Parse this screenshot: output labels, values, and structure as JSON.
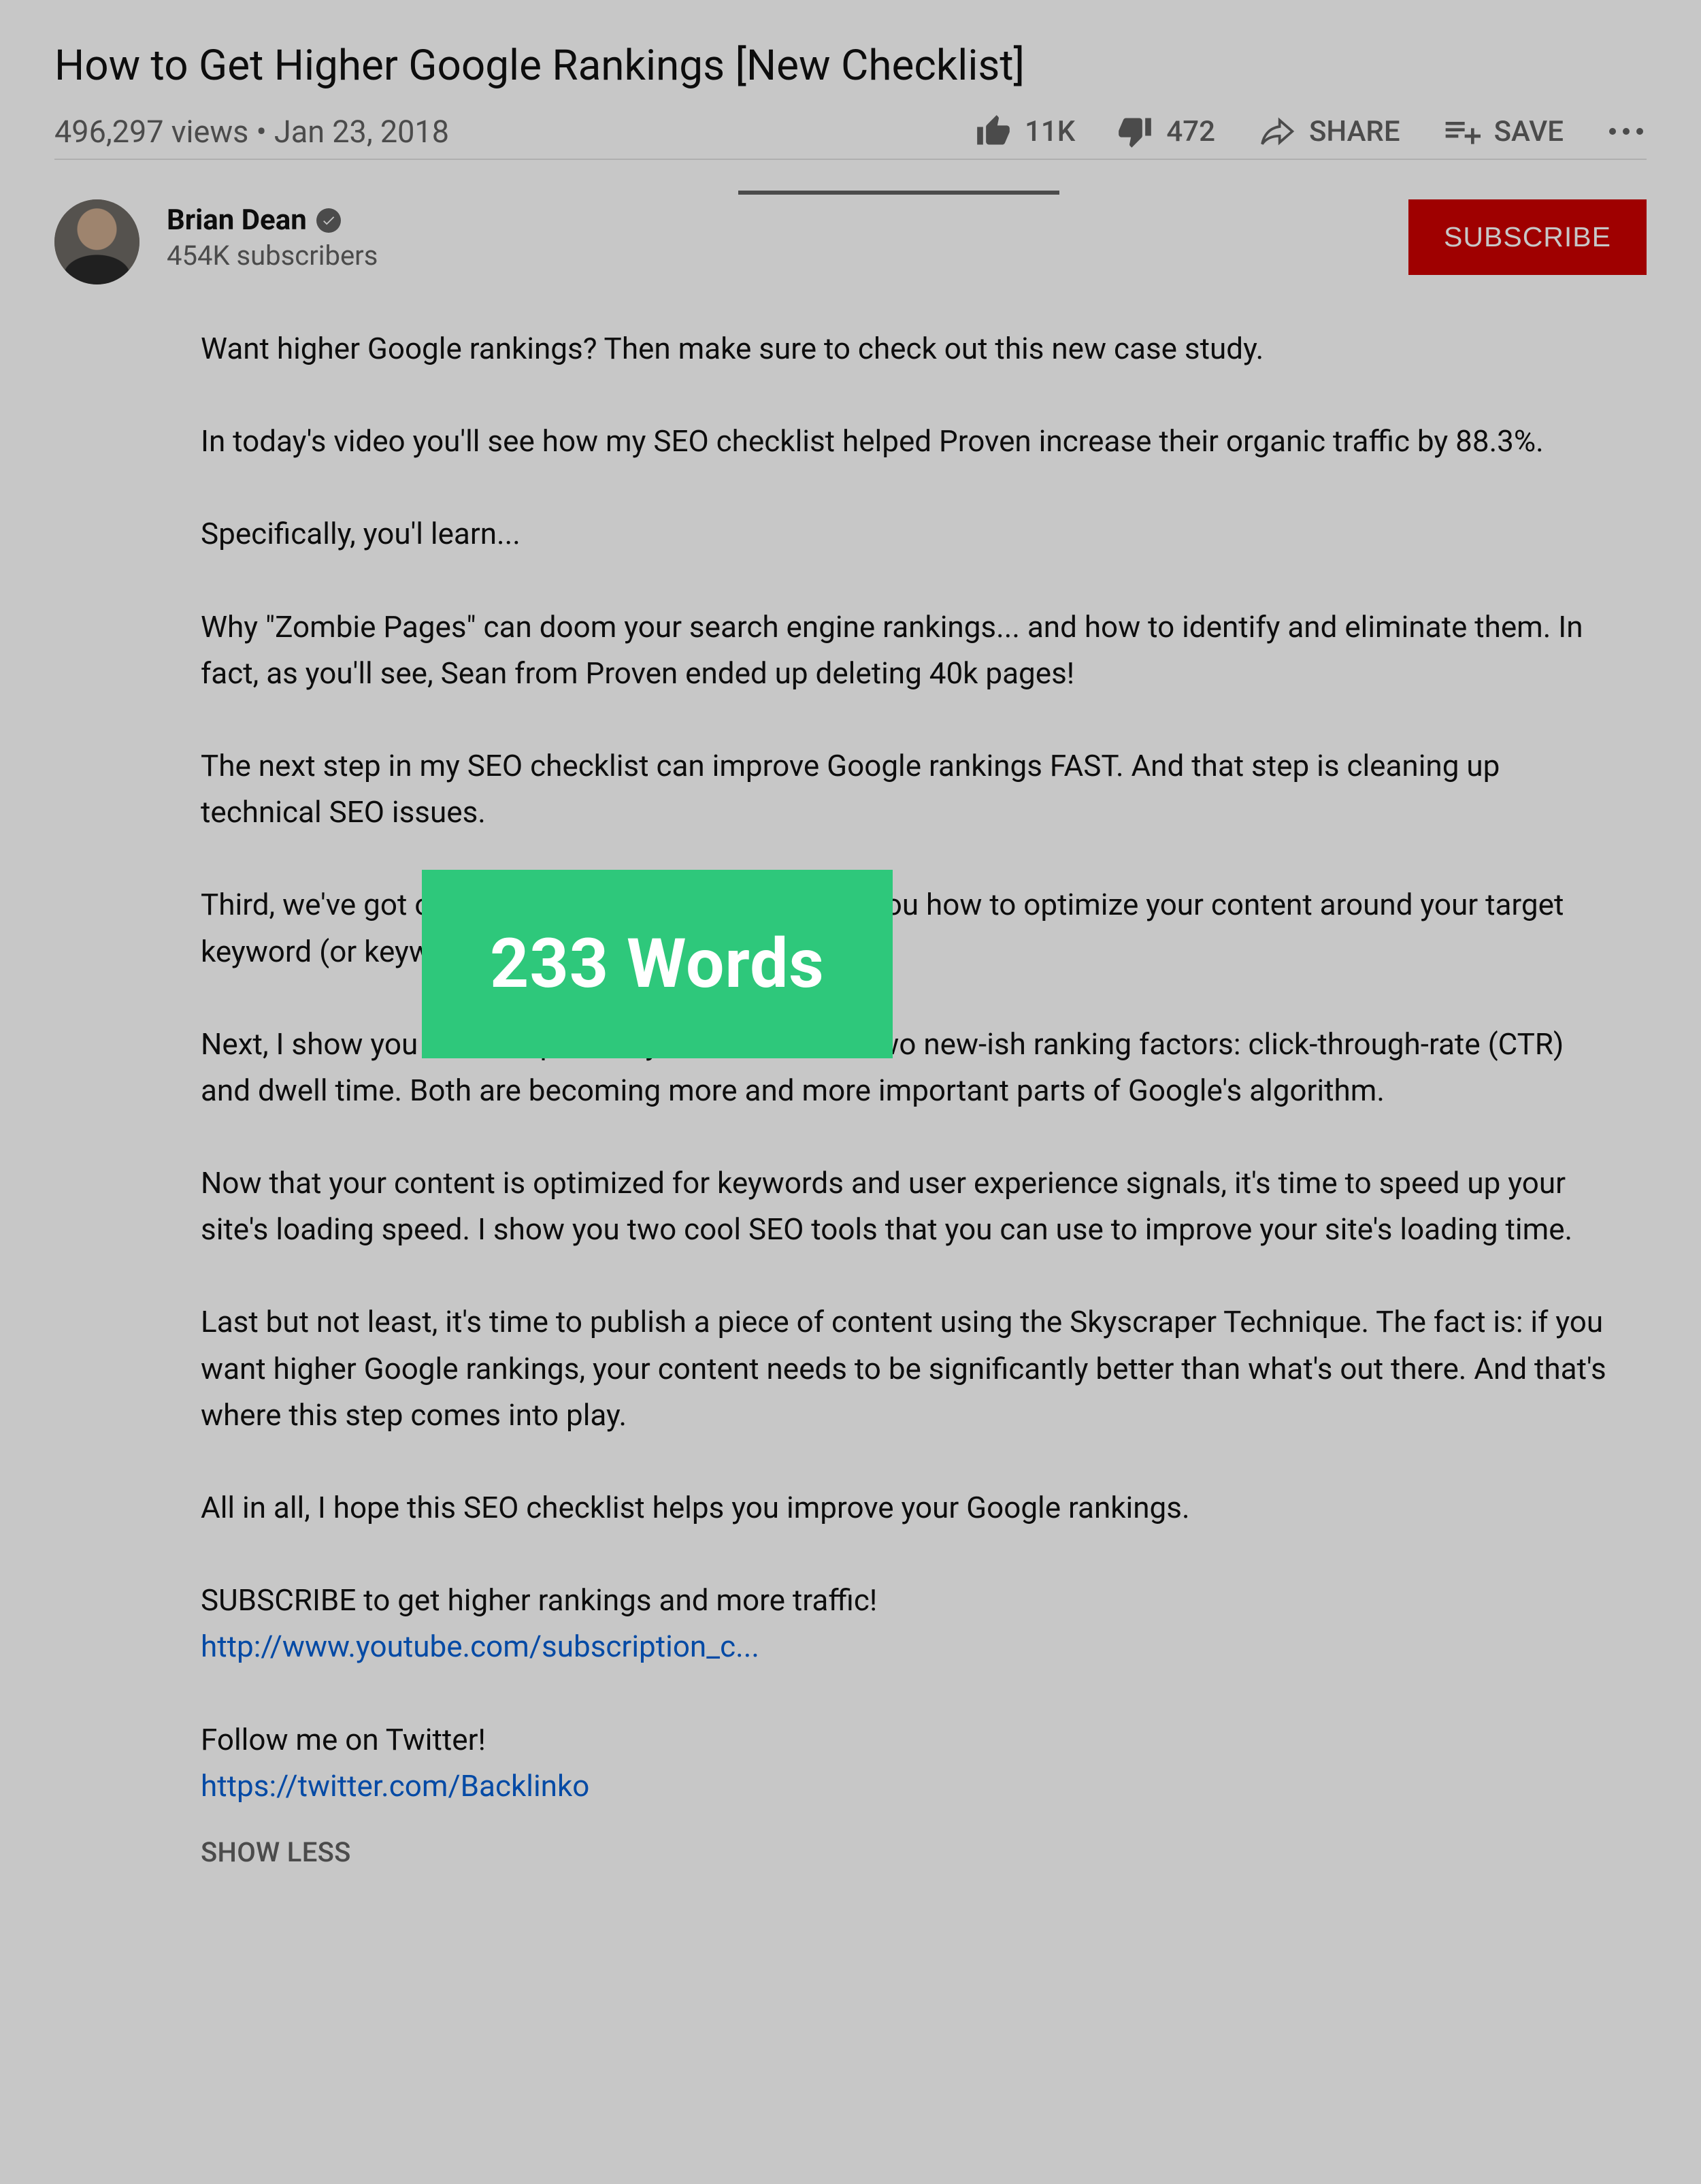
{
  "video": {
    "title": "How to Get Higher Google Rankings [New Checklist]",
    "views_text": "496,297 views",
    "date_text": "Jan 23, 2018",
    "separator": " • "
  },
  "actions": {
    "like_count": "11K",
    "dislike_count": "472",
    "share_label": "SHARE",
    "save_label": "SAVE"
  },
  "channel": {
    "name": "Brian Dean",
    "subscribers": "454K subscribers",
    "subscribe_label": "SUBSCRIBE"
  },
  "description": {
    "p1": "Want higher Google rankings? Then make sure to check out this new case study.",
    "p2": "In today's video you'll see how my SEO checklist helped Proven increase their organic traffic by 88.3%.",
    "p3": "Specifically, you'l learn...",
    "p4": "Why \"Zombie Pages\" can doom your search engine rankings... and how to identify and eliminate them. In fact, as you'll see, Sean from Proven ended up deleting 40k pages!",
    "p5": "The next step in my SEO checklist can improve Google rankings FAST. And that step is cleaning up technical SEO issues.",
    "p6": "Third, we've got on-page SEO. Here's where I show you how to optimize your content around your target keyword (or keywords).",
    "p7": "Next, I show you how to optimize your site around two new-ish ranking factors: click-through-rate (CTR) and dwell time. Both are becoming more and more important parts of Google's algorithm.",
    "p8": "Now that your content is optimized for keywords and user experience signals, it's time to speed up your site's loading speed. I show you two cool SEO tools that you can use to improve your site's loading time.",
    "p9": "Last but not least, it's time to publish a piece of content using the Skyscraper Technique. The fact is: if you want higher Google rankings, your content needs to be significantly better than what's out there. And that's where this step comes into play.",
    "p10": "All in all, I hope this SEO checklist helps you improve your Google rankings.",
    "sub_cta": "SUBSCRIBE to get higher rankings and more traffic!",
    "sub_link": "http://www.youtube.com/subscription_c...",
    "twitter_cta": "Follow me on Twitter!",
    "twitter_link": "https://twitter.com/Backlinko",
    "show_less": "SHOW LESS"
  },
  "overlay_badge": {
    "text": "233 Words"
  }
}
